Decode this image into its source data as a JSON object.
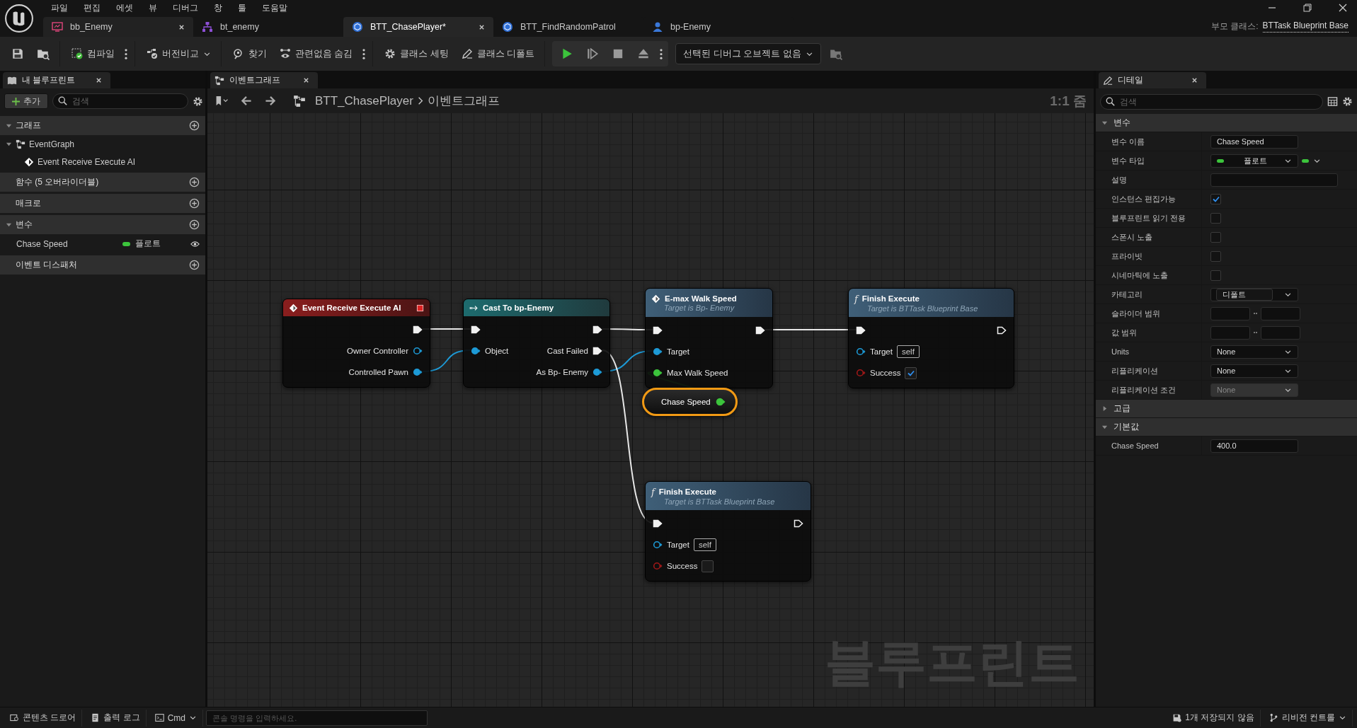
{
  "menu": [
    "파일",
    "편집",
    "에셋",
    "뷰",
    "디버그",
    "창",
    "툴",
    "도움말"
  ],
  "document_tabs": [
    {
      "label": "bb_Enemy",
      "kind": "blackboard",
      "selected": false,
      "closable": true
    },
    {
      "label": "bt_enemy",
      "kind": "behavior_tree",
      "selected": false,
      "closable": false
    },
    {
      "label": "BTT_ChasePlayer*",
      "kind": "blueprint",
      "selected": true,
      "closable": true
    },
    {
      "label": "BTT_FindRandomPatrol",
      "kind": "blueprint",
      "selected": false,
      "closable": false
    },
    {
      "label": "bp-Enemy",
      "kind": "character",
      "selected": false,
      "closable": false
    }
  ],
  "parent_class": {
    "label": "부모 클래스:",
    "value": "BTTask Blueprint Base"
  },
  "toolbar": [
    [
      {
        "kind": "save"
      },
      {
        "kind": "browse"
      }
    ],
    [
      {
        "kind": "compile",
        "label": "컴파일"
      },
      {
        "kind": "more"
      }
    ],
    [
      {
        "kind": "diff",
        "label": "버전비교"
      }
    ],
    [
      {
        "kind": "find",
        "label": "찾기"
      },
      {
        "kind": "hide_unrelated",
        "label": "관련없음 숨김"
      },
      {
        "kind": "more"
      }
    ],
    [
      {
        "kind": "class_settings",
        "label": "클래스 세팅"
      },
      {
        "kind": "class_defaults",
        "label": "클래스 디폴트"
      }
    ],
    [
      {
        "kind": "play"
      },
      {
        "kind": "step"
      },
      {
        "kind": "stop"
      },
      {
        "kind": "eject"
      },
      {
        "kind": "more"
      }
    ],
    [
      {
        "kind": "debug_select",
        "label": "선택된 디버그 오브젝트 없음"
      },
      {
        "kind": "debug_find"
      }
    ]
  ],
  "my_blueprint": {
    "title": "내 블루프린트",
    "add_label": "추가",
    "search_placeholder": "검색",
    "sections": [
      {
        "label": "그래프",
        "expanded": true,
        "children": [
          {
            "label": "EventGraph",
            "kind": "graph",
            "expanded": true,
            "children": [
              {
                "label": "Event Receive Execute AI",
                "kind": "event"
              }
            ]
          }
        ]
      },
      {
        "label": "함수 (5 오버라이더블)",
        "expanded": false
      },
      {
        "label": "매크로",
        "expanded": false
      },
      {
        "label": "변수",
        "expanded": true,
        "variables": [
          {
            "name": "Chase Speed",
            "type": "플로트",
            "color": "#3cc43c"
          }
        ]
      },
      {
        "label": "이벤트 디스패처",
        "expanded": false
      }
    ]
  },
  "graph": {
    "tab": "이벤트그래프",
    "breadcrumb": [
      "BTT_ChasePlayer",
      "이벤트그래프"
    ],
    "zoom": "1:1 줌",
    "graph_type": "블루프린트",
    "nodes": [
      {
        "kind": "event",
        "title": "Event Receive Execute AI",
        "selected": false,
        "rows": [
          {
            "right": {
              "kind": "exec",
              "connected": true
            }
          },
          {
            "right": {
              "kind": "object",
              "label": "Owner Controller",
              "connected": false
            }
          },
          {
            "right": {
              "kind": "object",
              "label": "Controlled Pawn",
              "connected": true
            }
          }
        ]
      },
      {
        "kind": "cast",
        "title": "Cast To bp-Enemy",
        "selected": false,
        "rows": [
          {
            "left": {
              "kind": "exec",
              "connected": true
            },
            "right": {
              "kind": "exec",
              "connected": true
            }
          },
          {
            "left": {
              "kind": "object",
              "label": "Object",
              "connected": true
            },
            "right": {
              "kind": "exec",
              "label": "Cast Failed",
              "connected": true
            }
          },
          {
            "right": {
              "kind": "object",
              "label": "As Bp- Enemy",
              "connected": true
            }
          }
        ]
      },
      {
        "kind": "call",
        "title": "E-max Walk Speed",
        "subtitle": "Target is Bp- Enemy",
        "selected": false,
        "rows": [
          {
            "left": {
              "kind": "exec",
              "connected": true
            },
            "right": {
              "kind": "exec",
              "connected": true
            }
          },
          {
            "left": {
              "kind": "object",
              "label": "Target",
              "connected": true
            }
          },
          {
            "left": {
              "kind": "float",
              "label": "Max Walk Speed",
              "connected": true
            }
          }
        ]
      },
      {
        "kind": "function",
        "glyph": "f",
        "title": "Finish Execute",
        "subtitle": "Target is BTTask Blueprint Base",
        "selected": false,
        "rows": [
          {
            "left": {
              "kind": "exec",
              "connected": true
            },
            "right": {
              "kind": "exec",
              "connected": false
            }
          },
          {
            "left": {
              "kind": "object",
              "label": "Target",
              "connected": false,
              "value": "self"
            }
          },
          {
            "left": {
              "kind": "bool",
              "label": "Success",
              "connected": false,
              "checked": true
            }
          }
        ]
      },
      {
        "kind": "variable",
        "title": "Chase Speed",
        "selected": true,
        "rows": [
          {
            "right": {
              "kind": "float",
              "connected": true
            }
          }
        ]
      },
      {
        "kind": "function",
        "glyph": "f",
        "title": "Finish Execute",
        "subtitle": "Target is BTTask Blueprint Base",
        "selected": false,
        "rows": [
          {
            "left": {
              "kind": "exec",
              "connected": true
            },
            "right": {
              "kind": "exec",
              "connected": false
            }
          },
          {
            "left": {
              "kind": "object",
              "label": "Target",
              "connected": false,
              "value": "self"
            }
          },
          {
            "left": {
              "kind": "bool",
              "label": "Success",
              "connected": false,
              "checked": false
            }
          }
        ]
      }
    ]
  },
  "details": {
    "title": "디테일",
    "search_placeholder": "검색",
    "sections": [
      {
        "label": "변수",
        "expanded": true,
        "rows": [
          {
            "label": "변수 이름",
            "kind": "text",
            "value": "Chase Speed"
          },
          {
            "label": "변수 타입",
            "kind": "type",
            "value": "플로트"
          },
          {
            "label": "설명",
            "kind": "wide_text"
          },
          {
            "label": "인스턴스 편집가능",
            "kind": "checkbox",
            "checked": true
          },
          {
            "label": "블루프린트 읽기 전용",
            "kind": "checkbox",
            "checked": false
          },
          {
            "label": "스폰시 노출",
            "kind": "checkbox",
            "checked": false
          },
          {
            "label": "프라이빗",
            "kind": "checkbox",
            "checked": false
          },
          {
            "label": "시네마틱에 노출",
            "kind": "checkbox",
            "checked": false
          },
          {
            "label": "카테고리",
            "kind": "combo",
            "value": "디폴트"
          },
          {
            "label": "슬라이더 범위",
            "kind": "range"
          },
          {
            "label": "값 범위",
            "kind": "range"
          },
          {
            "label": "Units",
            "kind": "dropdown",
            "value": "None",
            "disabled": false
          },
          {
            "label": "리플리케이션",
            "kind": "dropdown",
            "value": "None",
            "disabled": false
          },
          {
            "label": "리플리케이션 조건",
            "kind": "dropdown",
            "value": "None",
            "disabled": true
          }
        ]
      },
      {
        "label": "고급",
        "expanded": false
      },
      {
        "label": "기본값",
        "expanded": true,
        "rows": [
          {
            "label": "Chase Speed",
            "kind": "text",
            "value": "400.0"
          }
        ]
      }
    ]
  },
  "status_bar": {
    "left": [
      {
        "kind": "drawer",
        "label": "콘텐츠 드로어"
      },
      {
        "kind": "log",
        "label": "출력 로그"
      },
      {
        "kind": "cmd",
        "label": "Cmd"
      }
    ],
    "console_placeholder": "콘솔 명령을 입력하세요.",
    "right": [
      {
        "kind": "unsaved",
        "label": "1개 저장되지 않음"
      },
      {
        "kind": "revision",
        "label": "리비전 컨트롤"
      }
    ]
  }
}
